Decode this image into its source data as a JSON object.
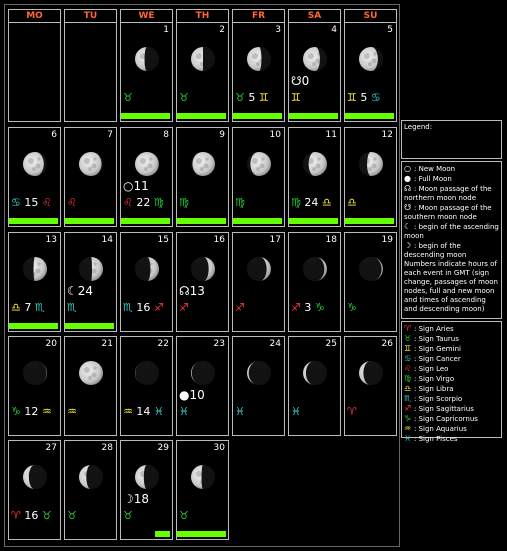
{
  "weekdays": [
    "MO",
    "TU",
    "WE",
    "TH",
    "FR",
    "SA",
    "SU"
  ],
  "days": [
    {
      "day": "1",
      "phase": 0.4,
      "waxing": false,
      "sign": "♉",
      "signColor": "#22cc33",
      "bar": 1
    },
    {
      "day": "2",
      "phase": 0.5,
      "waxing": false,
      "sign": "♉",
      "signColor": "#22cc33",
      "bar": 1
    },
    {
      "day": "3",
      "phase": 0.6,
      "waxing": false,
      "sign": "♉",
      "signColor": "#22cc33",
      "time": "5",
      "sign2": "♊",
      "sign2Color": "#ffee33",
      "bar": 1
    },
    {
      "day": "4",
      "phase": 0.7,
      "waxing": false,
      "event": "☋0",
      "sign": "♊",
      "signColor": "#ffee33",
      "bar": 1
    },
    {
      "day": "5",
      "phase": 0.78,
      "waxing": false,
      "sign": "♊",
      "signColor": "#ffee33",
      "time": "5",
      "sign2": "♋",
      "sign2Color": "#33cccc",
      "bar": 1
    },
    {
      "day": "6",
      "phase": 0.86,
      "waxing": false,
      "sign": "♋",
      "signColor": "#33cccc",
      "time": "15",
      "sign2": "♌",
      "sign2Color": "#ff3333",
      "bar": 1
    },
    {
      "day": "7",
      "phase": 0.93,
      "waxing": false,
      "sign": "♌",
      "signColor": "#ff3333",
      "bar": 1
    },
    {
      "day": "8",
      "phase": 0.98,
      "waxing": false,
      "event": "○11",
      "sign": "♌",
      "signColor": "#ff3333",
      "time": "22",
      "sign2": "♍",
      "sign2Color": "#22cc33",
      "bar": 1
    },
    {
      "day": "9",
      "phase": 0.93,
      "waxing": true,
      "sign": "♍",
      "signColor": "#22cc33",
      "bar": 1
    },
    {
      "day": "10",
      "phase": 0.85,
      "waxing": true,
      "sign": "♍",
      "signColor": "#22cc33",
      "bar": 1
    },
    {
      "day": "11",
      "phase": 0.76,
      "waxing": true,
      "sign": "♍",
      "signColor": "#22cc33",
      "time": "24",
      "sign2": "♎",
      "sign2Color": "#ffee33",
      "bar": 1
    },
    {
      "day": "12",
      "phase": 0.66,
      "waxing": true,
      "sign": "♎",
      "signColor": "#ffee33",
      "bar": 1
    },
    {
      "day": "13",
      "phase": 0.56,
      "waxing": true,
      "sign": "♎",
      "signColor": "#ffee33",
      "time": "7",
      "sign2": "♏",
      "sign2Color": "#33cccc",
      "bar": 1
    },
    {
      "day": "14",
      "phase": 0.46,
      "waxing": true,
      "event": "☾24",
      "sign": "♏",
      "signColor": "#33cccc",
      "bar": 1
    },
    {
      "day": "15",
      "phase": 0.36,
      "waxing": true,
      "sign": "♏",
      "signColor": "#33cccc",
      "time": "16",
      "sign2": "♐",
      "sign2Color": "#ff3333"
    },
    {
      "day": "16",
      "phase": 0.27,
      "waxing": true,
      "event": "☊13",
      "sign": "♐",
      "signColor": "#ff3333"
    },
    {
      "day": "17",
      "phase": 0.19,
      "waxing": true,
      "sign": "♐",
      "signColor": "#ff3333"
    },
    {
      "day": "18",
      "phase": 0.12,
      "waxing": true,
      "sign": "♐",
      "signColor": "#ff3333",
      "time": "3",
      "sign2": "♑",
      "sign2Color": "#22cc33"
    },
    {
      "day": "19",
      "phase": 0.07,
      "waxing": true,
      "sign": "♑",
      "signColor": "#22cc33"
    },
    {
      "day": "20",
      "phase": 0.03,
      "waxing": true,
      "sign": "♑",
      "signColor": "#22cc33",
      "time": "12",
      "sign2": "♒",
      "sign2Color": "#ffee33"
    },
    {
      "day": "21",
      "phase": 0.01,
      "waxing": true,
      "sign": "♒",
      "signColor": "#ffee33"
    },
    {
      "day": "22",
      "phase": 0.02,
      "waxing": false,
      "sign": "♒",
      "signColor": "#ffee33",
      "time": "14",
      "sign2": "♓",
      "sign2Color": "#33cccc"
    },
    {
      "day": "23",
      "phase": 0.04,
      "waxing": false,
      "event": "●10",
      "sign": "♓",
      "signColor": "#33cccc"
    },
    {
      "day": "24",
      "phase": 0.08,
      "waxing": false,
      "sign": "♓",
      "signColor": "#33cccc"
    },
    {
      "day": "25",
      "phase": 0.13,
      "waxing": false,
      "sign": "♓",
      "signColor": "#33cccc"
    },
    {
      "day": "26",
      "phase": 0.19,
      "waxing": false,
      "sign": "♈",
      "signColor": "#ff3333"
    },
    {
      "day": "27",
      "phase": 0.25,
      "waxing": false,
      "sign": "♈",
      "signColor": "#ff3333",
      "time": "16",
      "sign2": "♉",
      "sign2Color": "#22cc33"
    },
    {
      "day": "28",
      "phase": 0.31,
      "waxing": false,
      "sign": "♉",
      "signColor": "#22cc33"
    },
    {
      "day": "29",
      "phase": 0.37,
      "waxing": false,
      "event": "☽18",
      "sign": "♉",
      "signColor": "#22cc33",
      "bar": 0.3
    },
    {
      "day": "30",
      "phase": 0.44,
      "waxing": false,
      "sign": "♉",
      "signColor": "#22cc33",
      "bar": 1
    }
  ],
  "legend": {
    "title": "Legend:",
    "items": [
      {
        "sym": "○",
        "text": ": New Moon"
      },
      {
        "sym": "●",
        "text": ": Full Moon"
      },
      {
        "sym": "☊",
        "text": ": Moon passage of the northern moon node"
      },
      {
        "sym": "☋",
        "text": ": Moon passage of the southern moon node"
      },
      {
        "sym": "☾",
        "text": ": begin of the ascending moon"
      },
      {
        "sym": "☽",
        "text": ": begin of the descending moon"
      }
    ],
    "note": "Numbers indicate hours of each event in GMT (sign change, passages of moon nodes, full and new moon and times of ascending and descending moon)"
  },
  "signs": [
    {
      "sym": "♈",
      "color": "#ff3333",
      "text": ": Sign Aries"
    },
    {
      "sym": "♉",
      "color": "#22cc33",
      "text": ": Sign Taurus"
    },
    {
      "sym": "♊",
      "color": "#ffee33",
      "text": ": Sign Gemini"
    },
    {
      "sym": "♋",
      "color": "#33cccc",
      "text": ": Sign Cancer"
    },
    {
      "sym": "♌",
      "color": "#ff3333",
      "text": ": Sign Leo"
    },
    {
      "sym": "♍",
      "color": "#22cc33",
      "text": ": Sign Virgo"
    },
    {
      "sym": "♎",
      "color": "#ffee33",
      "text": ": Sign Libra"
    },
    {
      "sym": "♏",
      "color": "#33cccc",
      "text": ": Sign Scorpio"
    },
    {
      "sym": "♐",
      "color": "#ff3333",
      "text": ": Sign Sagittarius"
    },
    {
      "sym": "♑",
      "color": "#22cc33",
      "text": ": Sign Capricornus"
    },
    {
      "sym": "♒",
      "color": "#ffee33",
      "text": ": Sign Aquarius"
    },
    {
      "sym": "♓",
      "color": "#33cccc",
      "text": ": Sign Pisces"
    }
  ]
}
